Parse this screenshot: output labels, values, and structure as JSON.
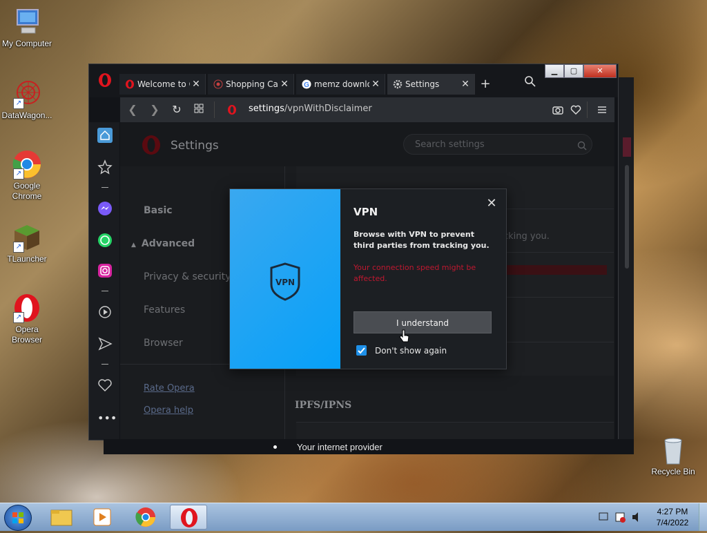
{
  "desktop": {
    "icons": [
      {
        "label": "My Computer"
      },
      {
        "label": "DataWagon..."
      },
      {
        "label": "Google Chrome"
      },
      {
        "label": "TLauncher"
      },
      {
        "label": "Opera Browser"
      },
      {
        "label": "Recycle Bin"
      }
    ]
  },
  "browser": {
    "tabs": [
      {
        "title": "Welcome to O",
        "icon": "opera-icon"
      },
      {
        "title": "Shopping Car",
        "icon": "flower-icon"
      },
      {
        "title": "memz downlo",
        "icon": "google-icon"
      },
      {
        "title": "Settings",
        "icon": "gear-icon",
        "active": true
      }
    ],
    "url_host": "settings",
    "url_path": "/vpnWithDisclaimer"
  },
  "settings": {
    "title": "Settings",
    "search_placeholder": "Search settings",
    "nav": {
      "basic": "Basic",
      "advanced": "Advanced",
      "privacy": "Privacy & security",
      "features": "Features",
      "browser": "Browser",
      "rate": "Rate Opera",
      "help": "Opera help"
    },
    "behind_text_1": "cking you.",
    "section_ipfs": "IPFS/IPNS"
  },
  "vpn_dialog": {
    "badge": "VPN",
    "title": "VPN",
    "description": "Browse with VPN to prevent third parties from tracking you.",
    "warning": "Your connection speed might be affected.",
    "button": "I understand",
    "checkbox_label": "Don't show again",
    "checkbox_checked": true,
    "accent_color": "#06a0f8",
    "warning_color": "#c01830"
  },
  "tooltip_bar": {
    "text": "Your internet provider"
  },
  "taskbar": {
    "time": "4:27 PM",
    "date": "7/4/2022"
  }
}
